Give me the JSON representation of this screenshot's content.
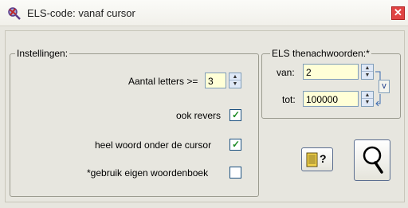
{
  "window": {
    "title": "ELS-code: vanaf cursor",
    "close_label": "✕"
  },
  "settings": {
    "legend": "Instellingen:",
    "min_letters_label": "Aantal letters >=",
    "min_letters_value": "3",
    "reverse_label": "ook revers",
    "reverse_checked": true,
    "whole_word_label": "heel woord onder de cursor",
    "whole_word_checked": true,
    "own_dictionary_label": "*gebruik eigen woordenboek",
    "own_dictionary_checked": false
  },
  "els": {
    "legend": "ELS thenachwoorden:*",
    "from_label": "van:",
    "from_value": "2",
    "to_label": "tot:",
    "to_value": "100000",
    "link_label": "v"
  },
  "buttons": {
    "help_label": "?",
    "search_icon": "magnifier-icon",
    "book_icon": "book-icon"
  },
  "colors": {
    "input_bg": "#ffffd7",
    "close_bg": "#e04343",
    "window_bg": "#e7e6df"
  }
}
